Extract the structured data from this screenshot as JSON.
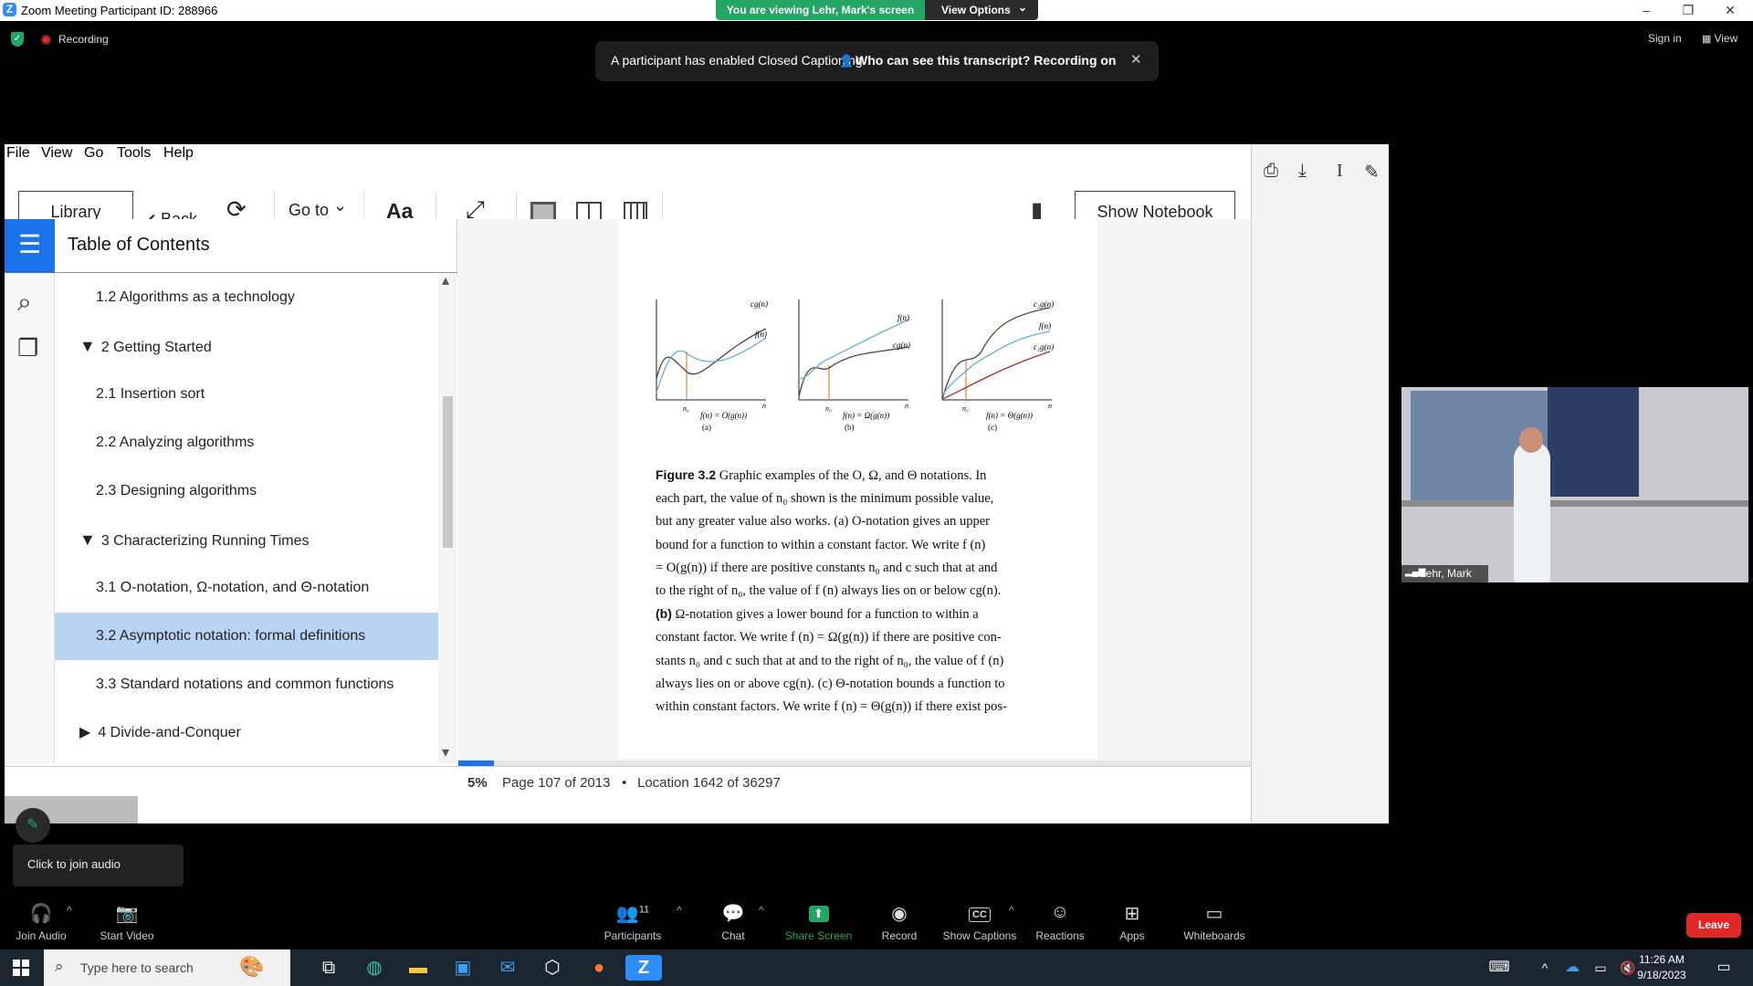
{
  "window": {
    "title": "Zoom Meeting Participant ID: 288966",
    "minimize_glyph": "–",
    "restore_glyph": "❐",
    "close_glyph": "✕"
  },
  "banner": {
    "viewing": "You are viewing Lehr, Mark's screen",
    "options": "View Options",
    "options_caret": "⌄"
  },
  "meeting": {
    "recording": "Recording",
    "sign_in": "Sign in",
    "view": "View",
    "cc_message": "A participant has enabled Closed Captioning",
    "cc_question": "Who can see this transcript? Recording on",
    "close_glyph": "✕"
  },
  "reader": {
    "menu": [
      "File",
      "View",
      "Go",
      "Tools",
      "Help"
    ],
    "toolbar": {
      "library": "Library",
      "back": "Back",
      "back_glyph": "‹",
      "sync_glyph": "⟳",
      "goto": "Go to",
      "goto_caret": "⌄",
      "font": "Aa",
      "fullscreen_glyph": "⤢",
      "bookmark_glyph": "▮",
      "show_notebook": "Show Notebook"
    },
    "icons": {
      "toc_glyph": "☰",
      "search_glyph": "⌕",
      "cards_glyph": "❐",
      "print_glyph": "⎙",
      "download_glyph": "⤓",
      "text_glyph": "I",
      "pen_glyph": "✎"
    },
    "toc": {
      "title": "Table of Contents",
      "scroll_up": "▴",
      "scroll_down": "▾",
      "items": [
        {
          "label": "1.2 Algorithms as a technology",
          "arrow": ""
        },
        {
          "label": "2 Getting Started",
          "arrow": "▼"
        },
        {
          "label": "2.1 Insertion sort",
          "arrow": ""
        },
        {
          "label": "2.2 Analyzing algorithms",
          "arrow": ""
        },
        {
          "label": "2.3 Designing algorithms",
          "arrow": ""
        },
        {
          "label": "3 Characterizing Running Times",
          "arrow": "▼"
        },
        {
          "label": "3.1 O-notation, Ω-notation, and Θ-notation",
          "arrow": ""
        },
        {
          "label": "3.2 Asymptotic notation: formal definitions",
          "arrow": ""
        },
        {
          "label": "3.3 Standard notations and common functions",
          "arrow": ""
        },
        {
          "label": "4 Divide-and-Conquer",
          "arrow": "▶"
        }
      ]
    },
    "figure": {
      "panels": [
        {
          "upper": "cg(n)",
          "lower": "f(n)",
          "formula": "f(n) = O(g(n))",
          "tag": "(a)"
        },
        {
          "upper": "f(n)",
          "lower": "cg(n)",
          "formula": "f(n) = Ω(g(n))",
          "tag": "(b)"
        },
        {
          "upper": "c₂g(n)",
          "mid": "f(n)",
          "lower": "c₁g(n)",
          "formula": "f(n) = Θ(g(n))",
          "tag": "(c)"
        }
      ],
      "n0": "n₀",
      "n": "n"
    },
    "caption_lines": [
      {
        "bold": "Figure 3.2",
        "text": " Graphic examples of the O, Ω, and Θ notations. In"
      },
      {
        "bold": "",
        "text": "each part, the value of n₀ shown is the minimum possible value,"
      },
      {
        "bold": "",
        "text": "but any greater value also works. (a) O-notation gives an upper"
      },
      {
        "bold": "",
        "text": "bound for a function to within a constant factor. We write f (n)"
      },
      {
        "bold": "",
        "text": "= O(g(n)) if there are positive constants n₀ and c such that at and"
      },
      {
        "bold": "",
        "text": "to the right of n₀, the value of f (n) always lies on or below cg(n)."
      },
      {
        "bold": "(b)",
        "text": " Ω-notation gives a lower bound for a function to within a"
      },
      {
        "bold": "",
        "text": "constant factor. We write f (n) = Ω(g(n)) if there are positive con-"
      },
      {
        "bold": "",
        "text": "stants n₀ and c such that at and to the right of n₀, the value of f (n)"
      },
      {
        "bold": "",
        "text": "always lies on or above cg(n). (c) Θ-notation bounds a function to"
      },
      {
        "bold": "",
        "text": "within constant factors. We write f (n) = Θ(g(n)) if there exist pos-"
      }
    ],
    "status": {
      "percent": "5%",
      "page": "Page 107 of 2013",
      "separator": "•",
      "location": "Location 1642 of 36297",
      "progress_fraction": 0.05
    }
  },
  "video": {
    "name": "Lehr, Mark"
  },
  "audio_hint": "Click to join audio",
  "toolbar_items": [
    {
      "label": "Join Audio",
      "icon": "🎧"
    },
    {
      "label": "Start Video",
      "icon": "📷"
    },
    {
      "label": "Participants",
      "icon": "👥",
      "count": "11"
    },
    {
      "label": "Chat",
      "icon": "💬"
    },
    {
      "label": "Share Screen",
      "icon": "⬆"
    },
    {
      "label": "Record",
      "icon": "◉"
    },
    {
      "label": "Show Captions",
      "icon": "CC"
    },
    {
      "label": "Reactions",
      "icon": "☺"
    },
    {
      "label": "Apps",
      "icon": "⊞"
    },
    {
      "label": "Whiteboards",
      "icon": "▭"
    }
  ],
  "leave": "Leave",
  "taskbar": {
    "search_placeholder": "Type here to search",
    "time": "11:26 AM",
    "date": "9/18/2023"
  },
  "colors": {
    "accent": "#1a73e8",
    "zoom_green": "#23a566",
    "leave_red": "#e02828"
  }
}
